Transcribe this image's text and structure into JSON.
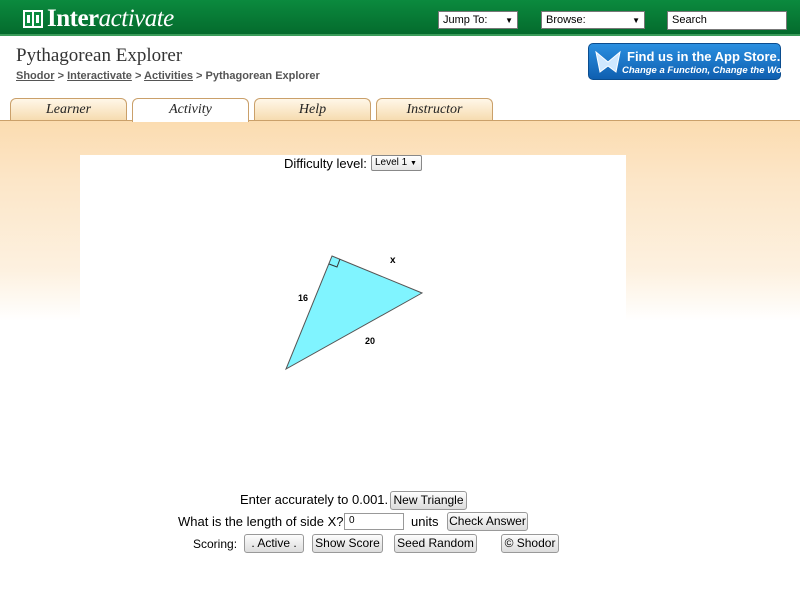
{
  "header": {
    "logo_text_bold": "Inter",
    "logo_text_italic": "activate",
    "jump_to": "Jump To:",
    "browse": "Browse:",
    "search_placeholder": "Search"
  },
  "page": {
    "title": "Pythagorean Explorer",
    "breadcrumb": [
      {
        "label": "Shodor",
        "link": true
      },
      {
        "label": "Interactivate",
        "link": true
      },
      {
        "label": "Activities",
        "link": true
      },
      {
        "label": "Pythagorean Explorer",
        "link": false
      }
    ],
    "breadcrumb_sep": ">"
  },
  "appstore": {
    "line1": "Find us in the App Store.",
    "line2": "Change a Function, Change the World"
  },
  "tabs": [
    {
      "label": "Learner",
      "active": false
    },
    {
      "label": "Activity",
      "active": true
    },
    {
      "label": "Help",
      "active": false
    },
    {
      "label": "Instructor",
      "active": false
    }
  ],
  "applet": {
    "difficulty_label": "Difficulty level:",
    "difficulty_value": "Level 1",
    "triangle": {
      "side_a_label": "16",
      "side_c_label": "20",
      "unknown_label": "x",
      "fill_color": "#80f4ff"
    },
    "accuracy_label": "Enter accurately to 0.001.",
    "new_triangle_button": "New Triangle",
    "question_label": "What is the length of side X?",
    "answer_value": "0",
    "units_label": "units",
    "check_answer_button": "Check Answer",
    "scoring_label": "Scoring:",
    "active_button": ". Active .",
    "show_score_button": "Show Score",
    "seed_random_button": "Seed Random",
    "shodor_button": "© Shodor"
  },
  "colors": {
    "topbar": "#0b8a3e",
    "tab_border": "#caa06a",
    "content_bg": "#fbdcb0"
  }
}
